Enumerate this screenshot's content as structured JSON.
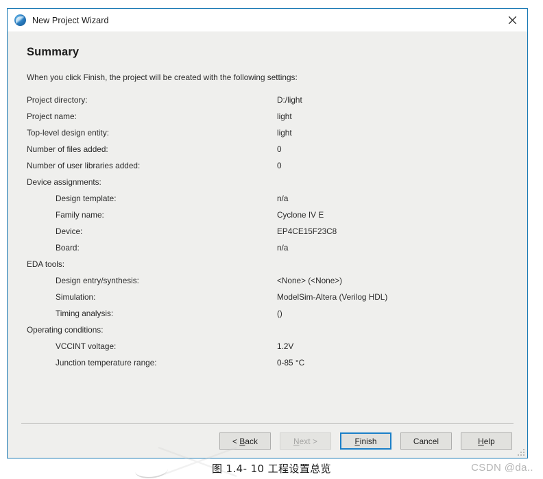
{
  "window": {
    "title": "New Project Wizard",
    "icon": "globe-icon",
    "close_label": "✕",
    "border_color": "#1878b4"
  },
  "page": {
    "heading": "Summary",
    "intro": "When you click Finish, the project will be created with the following settings:"
  },
  "summary": [
    {
      "label": "Project directory:",
      "value": "D:/light",
      "indent": false
    },
    {
      "label": "Project name:",
      "value": "light",
      "indent": false
    },
    {
      "label": "Top-level design entity:",
      "value": "light",
      "indent": false
    },
    {
      "label": "Number of files added:",
      "value": "0",
      "indent": false
    },
    {
      "label": "Number of user libraries added:",
      "value": "0",
      "indent": false
    },
    {
      "label": "Device assignments:",
      "value": "",
      "indent": false
    },
    {
      "label": "Design template:",
      "value": "n/a",
      "indent": true
    },
    {
      "label": "Family name:",
      "value": "Cyclone IV E",
      "indent": true
    },
    {
      "label": "Device:",
      "value": "EP4CE15F23C8",
      "indent": true
    },
    {
      "label": "Board:",
      "value": "n/a",
      "indent": true
    },
    {
      "label": "EDA tools:",
      "value": "",
      "indent": false
    },
    {
      "label": "Design entry/synthesis:",
      "value": "<None> (<None>)",
      "indent": true
    },
    {
      "label": "Simulation:",
      "value": "ModelSim-Altera (Verilog HDL)",
      "indent": true
    },
    {
      "label": "Timing analysis:",
      "value": "()",
      "indent": true
    },
    {
      "label": "Operating conditions:",
      "value": "",
      "indent": false
    },
    {
      "label": "VCCINT voltage:",
      "value": "1.2V",
      "indent": true
    },
    {
      "label": "Junction temperature range:",
      "value": "0-85 °C",
      "indent": true
    }
  ],
  "buttons": [
    {
      "name": "back",
      "pre": "< ",
      "mnemonic": "B",
      "post": "ack",
      "state": "enabled"
    },
    {
      "name": "next",
      "pre": "",
      "mnemonic": "N",
      "post": "ext >",
      "state": "disabled"
    },
    {
      "name": "finish",
      "pre": "",
      "mnemonic": "F",
      "post": "inish",
      "state": "focused"
    },
    {
      "name": "cancel",
      "pre": "",
      "mnemonic": "",
      "post": "Cancel",
      "state": "enabled"
    },
    {
      "name": "help",
      "pre": "",
      "mnemonic": "H",
      "post": "elp",
      "state": "enabled"
    }
  ],
  "caption": "图 1.4- 10 工程设置总览",
  "watermark": "CSDN @da..",
  "colors": {
    "dialog_bg": "#efefed",
    "titlebar_bg": "#ffffff",
    "focus_blue": "#1a7fc8",
    "text": "#2a2a2a"
  }
}
